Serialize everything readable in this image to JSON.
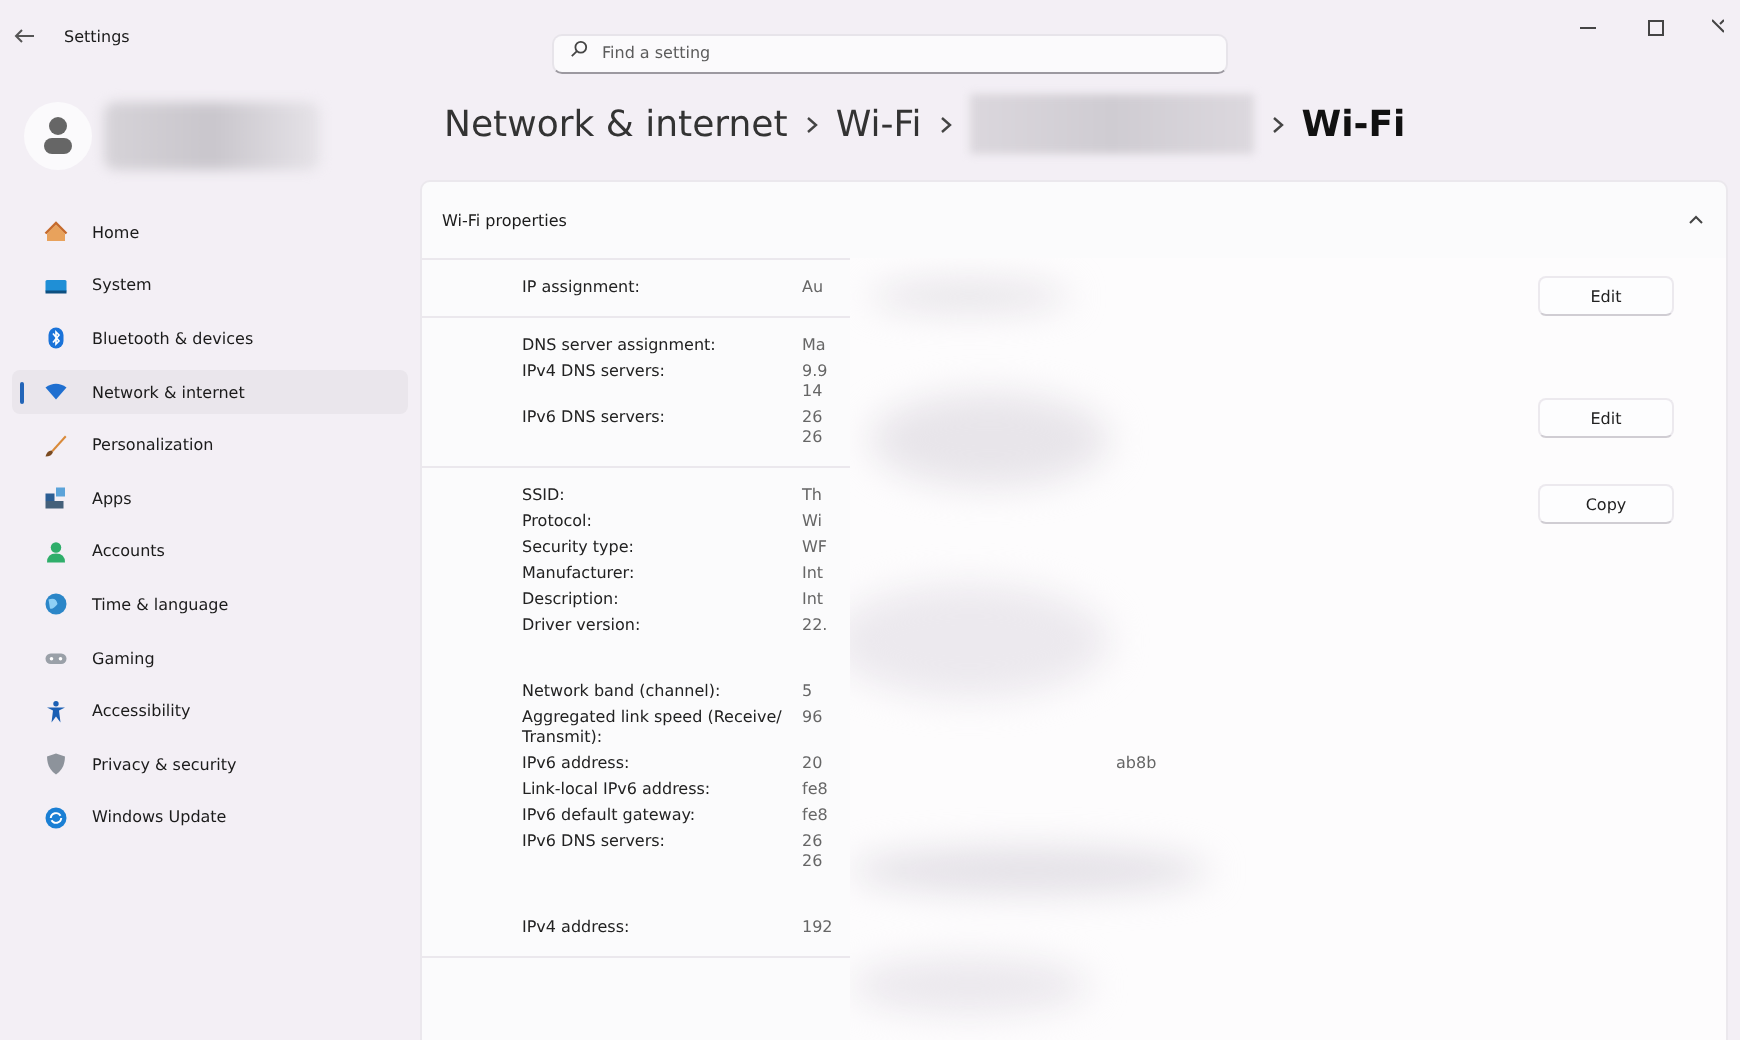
{
  "window": {
    "title": "Settings"
  },
  "search": {
    "placeholder": "Find a setting"
  },
  "breadcrumb": [
    {
      "kind": "text",
      "label": "Network & internet"
    },
    {
      "kind": "text",
      "label": "Wi-Fi"
    },
    {
      "kind": "redacted"
    },
    {
      "kind": "current",
      "label": "Wi-Fi"
    }
  ],
  "sidebar": {
    "items": [
      {
        "label": "Home",
        "selected": false
      },
      {
        "label": "System",
        "selected": false
      },
      {
        "label": "Bluetooth & devices",
        "selected": false
      },
      {
        "label": "Network & internet",
        "selected": true
      },
      {
        "label": "Personalization",
        "selected": false
      },
      {
        "label": "Apps",
        "selected": false
      },
      {
        "label": "Accounts",
        "selected": false
      },
      {
        "label": "Time & language",
        "selected": false
      },
      {
        "label": "Gaming",
        "selected": false
      },
      {
        "label": "Accessibility",
        "selected": false
      },
      {
        "label": "Privacy & security",
        "selected": false
      },
      {
        "label": "Windows Update",
        "selected": false
      }
    ]
  },
  "card": {
    "title": "Wi-Fi properties",
    "expanded": true,
    "sections": [
      {
        "button": "Edit",
        "rows": [
          {
            "label": "IP assignment:",
            "value": [
              "Au"
            ]
          }
        ]
      },
      {
        "button": "Edit",
        "rows": [
          {
            "label": "DNS server assignment:",
            "value": [
              "Ma"
            ]
          },
          {
            "label": "IPv4 DNS servers:",
            "value": [
              "9.9",
              "14"
            ]
          },
          {
            "label": "IPv6 DNS servers:",
            "value": [
              "26",
              "26"
            ]
          }
        ]
      },
      {
        "button": "Copy",
        "rows": [
          {
            "label": "SSID:",
            "value": [
              "Th"
            ]
          },
          {
            "label": "Protocol:",
            "value": [
              "Wi"
            ]
          },
          {
            "label": "Security type:",
            "value": [
              "WF"
            ]
          },
          {
            "label": "Manufacturer:",
            "value": [
              "Int"
            ]
          },
          {
            "label": "Description:",
            "value": [
              "Int"
            ]
          },
          {
            "label": "Driver version:",
            "value": [
              "22."
            ]
          },
          {
            "label": "Network band (channel):",
            "value": [
              "5"
            ],
            "spaced": true
          },
          {
            "label": "Aggregated link speed (Receive/ Transmit):",
            "value": [
              "96"
            ]
          },
          {
            "label": "IPv6 address:",
            "value": [
              "20"
            ],
            "tail": "ab8b"
          },
          {
            "label": "Link-local IPv6 address:",
            "value": [
              "fe8"
            ]
          },
          {
            "label": "IPv6 default gateway:",
            "value": [
              "fe8"
            ]
          },
          {
            "label": "IPv6 DNS servers:",
            "value": [
              "26",
              "26"
            ]
          },
          {
            "label": "IPv4 address:",
            "value": [
              "192"
            ],
            "spaced": true
          }
        ]
      }
    ]
  }
}
